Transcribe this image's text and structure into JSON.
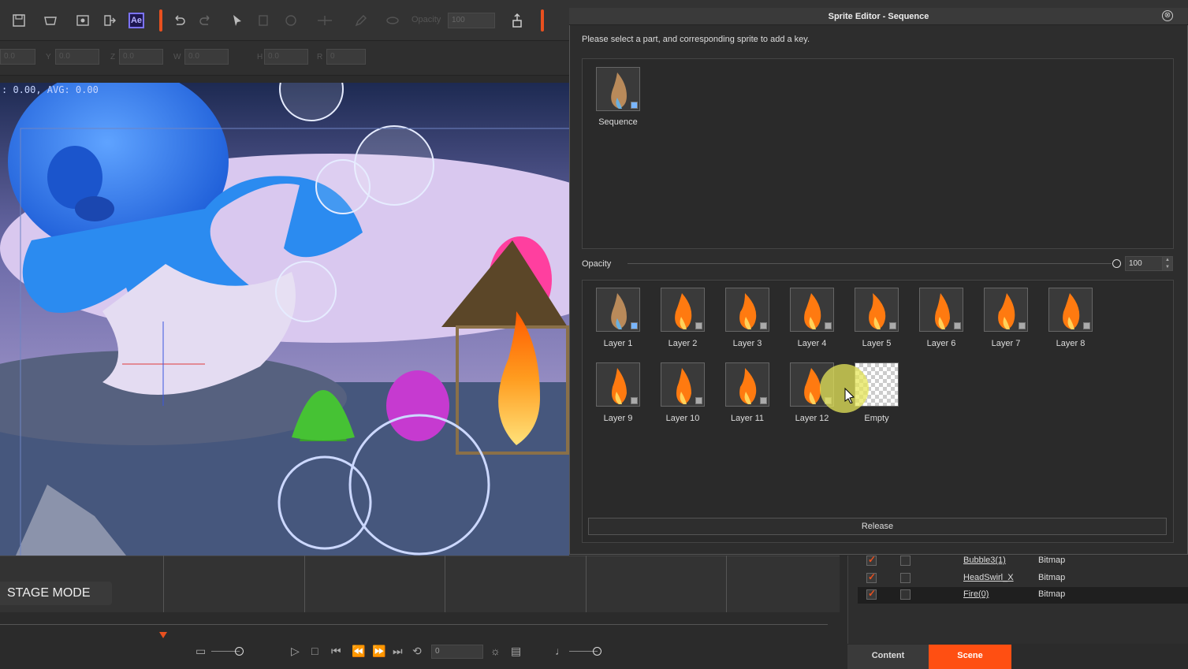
{
  "toolbar": {
    "opacity_label": "Opacity",
    "opacity_value": "100",
    "accent_color": "#e8501f",
    "icons": [
      "save-icon",
      "basket-icon",
      "preview-icon",
      "export-icon",
      "after-effects-icon",
      "undo-icon",
      "redo-icon",
      "select-arrow-icon",
      "copy-icon",
      "paste-icon",
      "align-icon",
      "pen-icon",
      "eye-icon",
      "attach-icon"
    ],
    "ae_label": "Ae"
  },
  "transform": {
    "fields": [
      {
        "label": "",
        "value": "0.0"
      },
      {
        "label": "Y",
        "value": "0.0"
      },
      {
        "label": "Z",
        "value": "0.0"
      },
      {
        "label": "W",
        "value": "0.0"
      },
      {
        "label": "H",
        "value": "0.0"
      },
      {
        "label": "R",
        "value": "0"
      }
    ]
  },
  "stage": {
    "fps_text": ": 0.00, AVG: 0.00",
    "mode_label": "STAGE MODE"
  },
  "playback": {
    "frame_value": "0",
    "icons": [
      "subtitle-icon",
      "play-icon",
      "stop-icon",
      "first-frame-icon",
      "prev-frame-icon",
      "next-frame-icon",
      "last-frame-icon",
      "loop-icon",
      "settings-icon",
      "timeline-icon",
      "music-icon"
    ]
  },
  "scene_list": {
    "rows": [
      {
        "name": "Bubble3(1)",
        "type": "Bitmap",
        "checked": true
      },
      {
        "name": "HeadSwirl_X",
        "type": "Bitmap",
        "checked": true
      },
      {
        "name": "Fire(0)",
        "type": "Bitmap",
        "checked": true
      }
    ],
    "tabs": {
      "content": "Content",
      "scene": "Scene"
    }
  },
  "dialog": {
    "title": "Sprite Editor - Sequence",
    "close_glyph": "⊗",
    "instruction": "Please select a part, and corresponding sprite to add a key.",
    "sequence_label": "Sequence",
    "opacity_label": "Opacity",
    "opacity_value": "100",
    "release_label": "Release",
    "layers": [
      {
        "label": "Layer 1"
      },
      {
        "label": "Layer 2"
      },
      {
        "label": "Layer 3"
      },
      {
        "label": "Layer 4"
      },
      {
        "label": "Layer 5"
      },
      {
        "label": "Layer 6"
      },
      {
        "label": "Layer 7"
      },
      {
        "label": "Layer 8"
      },
      {
        "label": "Layer 9"
      },
      {
        "label": "Layer 10"
      },
      {
        "label": "Layer 11"
      },
      {
        "label": "Layer 12"
      },
      {
        "label": "Empty"
      }
    ]
  }
}
